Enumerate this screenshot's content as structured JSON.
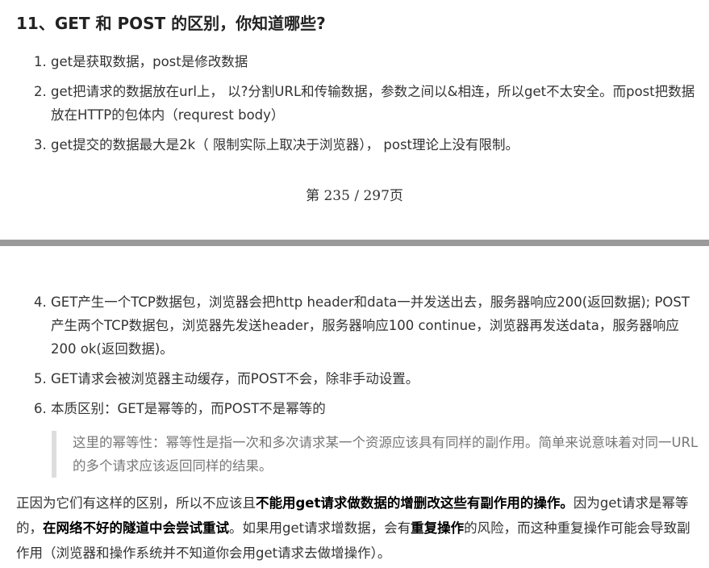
{
  "heading": "11、GET 和 POST 的区别，你知道哪些?",
  "list1": [
    {
      "num": "1.",
      "text": "get是获取数据，post是修改数据"
    },
    {
      "num": "2.",
      "text": "get把请求的数据放在url上， 以?分割URL和传输数据，参数之间以&相连，所以get不太安全。而post把数据放在HTTP的包体内（requrest body）"
    },
    {
      "num": "3.",
      "text": "get提交的数据最大是2k（ 限制实际上取决于浏览器）， post理论上没有限制。"
    }
  ],
  "page_number": "第 235 / 297页",
  "list2": [
    {
      "num": "4.",
      "text": "GET产生一个TCP数据包，浏览器会把http header和data一并发送出去，服务器响应200(返回数据); POST产生两个TCP数据包，浏览器先发送header，服务器响应100 continue，浏览器再发送data，服务器响应200 ok(返回数据)。"
    },
    {
      "num": "5.",
      "text": "GET请求会被浏览器主动缓存，而POST不会，除非手动设置。"
    },
    {
      "num": "6.",
      "text": "本质区别：GET是幂等的，而POST不是幂等的"
    }
  ],
  "quote": "这里的幂等性：幂等性是指一次和多次请求某一个资源应该具有同样的副作用。简单来说意味着对同一URL的多个请求应该返回同样的结果。",
  "paragraph": {
    "p1": "正因为它们有这样的区别，所以不应该且",
    "b1": "不能用get请求做数据的增删改这些有副作用的操作。",
    "p2": "因为get请求是幂等的，",
    "b2": "在网络不好的隧道中会尝试重试",
    "p3": "。如果用get请求增数据，会有",
    "b3": "重复操作",
    "p4": "的风险，而这种重复操作可能会导致副作用（浏览器和操作系统并不知道你会用get请求去做增操作）。"
  }
}
